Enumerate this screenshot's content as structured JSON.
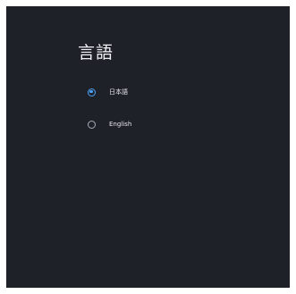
{
  "panel": {
    "title": "言語"
  },
  "options": [
    {
      "label": "日本語",
      "selected": true
    },
    {
      "label": "English",
      "selected": false
    }
  ],
  "colors": {
    "background": "#1f2129",
    "accent": "#4da3f5",
    "text": "#eef0f3",
    "radio_unselected": "#a7abb3"
  },
  "icons": {
    "selected": "radio-checked-icon",
    "unselected": "radio-unchecked-icon"
  }
}
